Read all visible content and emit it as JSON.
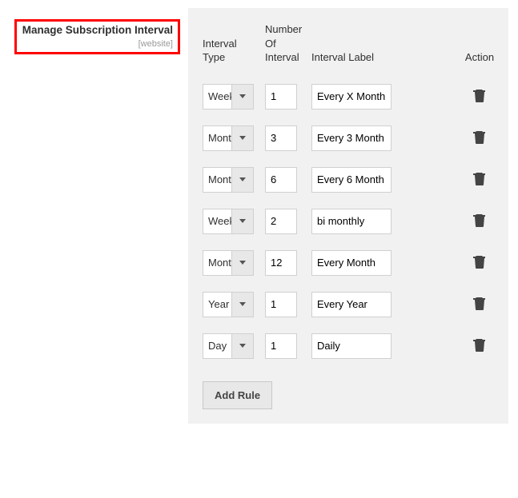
{
  "field": {
    "label": "Manage Subscription Interval",
    "sublabel": "[website]"
  },
  "headers": {
    "interval_type": "Interval Type",
    "number_of_interval": "Number Of Interval",
    "interval_label": "Interval Label",
    "action": "Action"
  },
  "rows": [
    {
      "type": "Week",
      "number": "1",
      "label": "Every X Month"
    },
    {
      "type": "Month",
      "number": "3",
      "label": "Every 3 Month"
    },
    {
      "type": "Month",
      "number": "6",
      "label": "Every 6 Month"
    },
    {
      "type": "Week",
      "number": "2",
      "label": "bi monthly"
    },
    {
      "type": "Month",
      "number": "12",
      "label": "Every Month"
    },
    {
      "type": "Year",
      "number": "1",
      "label": "Every Year"
    },
    {
      "type": "Day",
      "number": "1",
      "label": "Daily"
    }
  ],
  "buttons": {
    "add_rule": "Add Rule"
  }
}
